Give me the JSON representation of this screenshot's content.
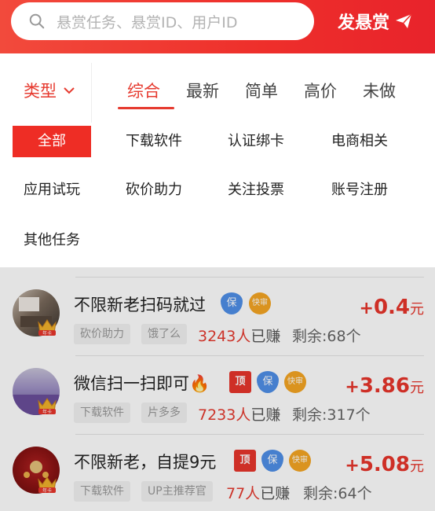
{
  "header": {
    "search_placeholder": "悬赏任务、悬赏ID、用户ID",
    "post_button_label": "发悬赏",
    "accent": "#ee2f2b"
  },
  "filter": {
    "type_label": "类型",
    "tabs": [
      {
        "label": "综合",
        "active": true
      },
      {
        "label": "最新",
        "active": false
      },
      {
        "label": "简单",
        "active": false
      },
      {
        "label": "高价",
        "active": false
      },
      {
        "label": "未做",
        "active": false
      }
    ]
  },
  "categories": [
    {
      "label": "全部",
      "active": true
    },
    {
      "label": "下载软件"
    },
    {
      "label": "认证绑卡"
    },
    {
      "label": "电商相关"
    },
    {
      "label": "应用试玩"
    },
    {
      "label": "砍价助力"
    },
    {
      "label": "关注投票"
    },
    {
      "label": "账号注册"
    },
    {
      "label": "其他任务"
    }
  ],
  "tasks": [
    {
      "title": "不限新老扫码就过",
      "badges": [
        "保",
        "快审"
      ],
      "tags": [
        "砍价助力",
        "饿了么"
      ],
      "earned_count": "3243人",
      "earned_suffix": "已赚",
      "remaining": "剩余:68个",
      "price_plus": "+",
      "price": "0.4",
      "price_unit": "元",
      "crown_label": "年卡"
    },
    {
      "title": "微信扫一扫即可🔥",
      "badges": [
        "顶",
        "保",
        "快审"
      ],
      "tags": [
        "下载软件",
        "片多多"
      ],
      "earned_count": "7233人",
      "earned_suffix": "已赚",
      "remaining": "剩余:317个",
      "price_plus": "+",
      "price": "3.86",
      "price_unit": "元",
      "crown_label": "年卡"
    },
    {
      "title": "不限新老，自提9元",
      "badges": [
        "顶",
        "保",
        "快审"
      ],
      "tags": [
        "下载软件",
        "UP主推荐官"
      ],
      "earned_count": "77人",
      "earned_suffix": "已赚",
      "remaining": "剩余:64个",
      "price_plus": "+",
      "price": "5.08",
      "price_unit": "元",
      "crown_label": "年卡"
    }
  ]
}
